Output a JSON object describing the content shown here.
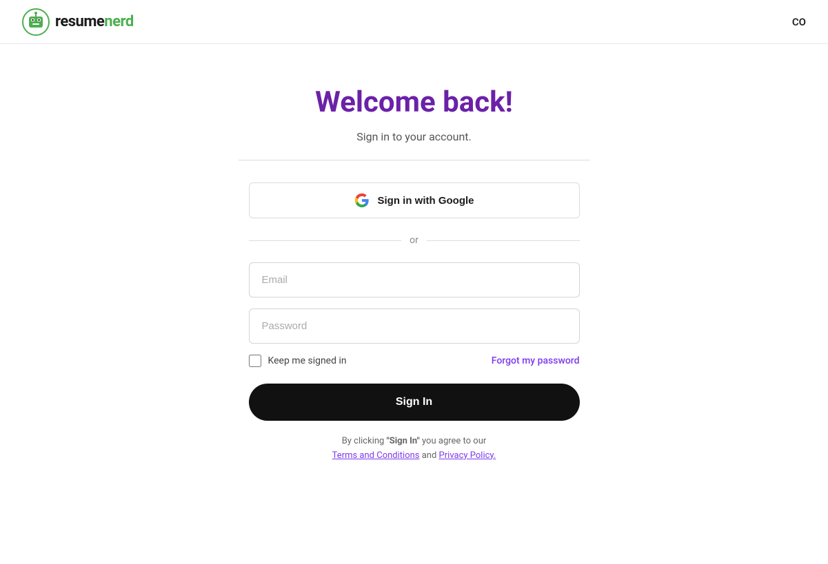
{
  "header": {
    "logo_resume": "resume",
    "logo_nerd": "nerd",
    "nav_label": "CO"
  },
  "main": {
    "welcome_title": "Welcome back!",
    "subtitle": "Sign in to your account.",
    "google_btn_label": "Sign in with Google",
    "or_text": "or",
    "email_placeholder": "Email",
    "password_placeholder": "Password",
    "keep_signed_in_label": "Keep me signed in",
    "forgot_password_label": "Forgot my password",
    "signin_btn_label": "Sign In",
    "terms_prefix": "By clicking ",
    "terms_sign_in_quote": "\"Sign In\"",
    "terms_middle": " you agree to our",
    "terms_link1": "Terms and Conditions",
    "terms_and": " and ",
    "terms_link2": "Privacy Policy."
  }
}
